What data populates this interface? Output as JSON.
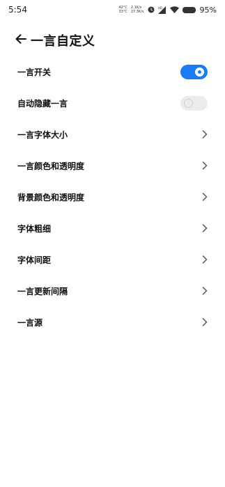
{
  "status_bar": {
    "time": "5:54",
    "temp_cpu": "42°C",
    "temp_battery": "33°C",
    "upload_speed": "2.1K/s",
    "download_speed": "27.3K/s",
    "network_badge": "HD",
    "battery_percent": "95%"
  },
  "header": {
    "title": "一言自定义"
  },
  "settings": {
    "items": [
      {
        "label": "一言开关",
        "control": "toggle",
        "state": "on"
      },
      {
        "label": "自动隐藏一言",
        "control": "toggle",
        "state": "off"
      },
      {
        "label": "一言字体大小",
        "control": "chevron"
      },
      {
        "label": "一言颜色和透明度",
        "control": "chevron"
      },
      {
        "label": "背景颜色和透明度",
        "control": "chevron"
      },
      {
        "label": "字体粗细",
        "control": "chevron"
      },
      {
        "label": "字体间距",
        "control": "chevron"
      },
      {
        "label": "一言更新间隔",
        "control": "chevron"
      },
      {
        "label": "一言源",
        "control": "chevron"
      }
    ]
  },
  "colors": {
    "accent": "#1a7cf2",
    "toggle_off": "#ececec"
  }
}
